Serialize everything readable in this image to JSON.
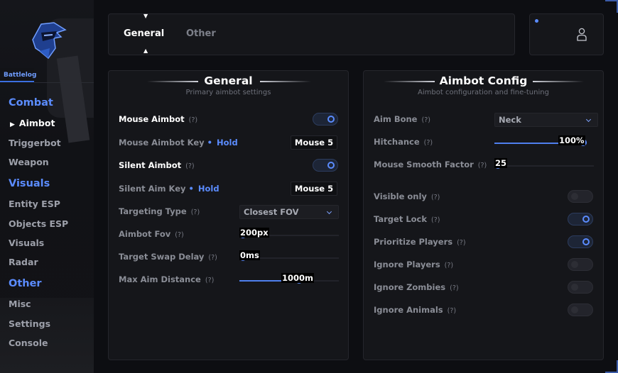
{
  "app": {
    "brand": "Battlelog"
  },
  "sidebar": {
    "groups": [
      {
        "label": "Combat",
        "items": [
          "Aimbot",
          "Triggerbot",
          "Weapon"
        ]
      },
      {
        "label": "Visuals",
        "items": [
          "Entity ESP",
          "Objects ESP",
          "Visuals",
          "Radar"
        ]
      },
      {
        "label": "Other",
        "items": [
          "Misc",
          "Settings",
          "Console"
        ]
      }
    ],
    "active_item": "Aimbot"
  },
  "tabs": [
    "General",
    "Other"
  ],
  "active_tab": "General",
  "colors": {
    "accent": "#5b8cff",
    "background": "#0d0e12",
    "panel": "#15161a"
  },
  "general": {
    "title": "General",
    "subtitle": "Primary aimbot settings",
    "help": "(?)",
    "mouse_aimbot": {
      "label": "Mouse Aimbot",
      "enabled": true
    },
    "mouse_aimbot_key": {
      "label": "Mouse Aimbot Key",
      "mode": "Hold",
      "key": "Mouse 5"
    },
    "silent_aimbot": {
      "label": "Silent Aimbot",
      "enabled": true
    },
    "silent_aim_key": {
      "label": "Silent Aim Key",
      "mode": "Hold",
      "key": "Mouse 5"
    },
    "targeting_type": {
      "label": "Targeting Type",
      "value": "Closest FOV"
    },
    "aimbot_fov": {
      "label": "Aimbot Fov",
      "value": "200px",
      "fraction": 0.0
    },
    "target_swap_delay": {
      "label": "Target Swap Delay",
      "value": "0ms",
      "fraction": 0.0
    },
    "max_aim_distance": {
      "label": "Max Aim Distance",
      "value": "1000m",
      "fraction": 0.61
    }
  },
  "aimbot_config": {
    "title": "Aimbot Config",
    "subtitle": "Aimbot configuration and fine-tuning",
    "help": "(?)",
    "aim_bone": {
      "label": "Aim Bone",
      "value": "Neck"
    },
    "hitchance": {
      "label": "Hitchance",
      "value": "100%",
      "fraction": 1.0
    },
    "mouse_smooth_factor": {
      "label": "Mouse Smooth Factor",
      "value": "25",
      "fraction": 0.0
    },
    "toggles": [
      {
        "label": "Visible only",
        "enabled": false
      },
      {
        "label": "Target Lock",
        "enabled": true
      },
      {
        "label": "Prioritize Players",
        "enabled": true
      },
      {
        "label": "Ignore Players",
        "enabled": false
      },
      {
        "label": "Ignore Zombies",
        "enabled": false
      },
      {
        "label": "Ignore Animals",
        "enabled": false
      }
    ]
  },
  "icons": {
    "logo": "helmet-mascot-logo",
    "user": "user-icon",
    "chevron": "chevron-down-icon"
  }
}
